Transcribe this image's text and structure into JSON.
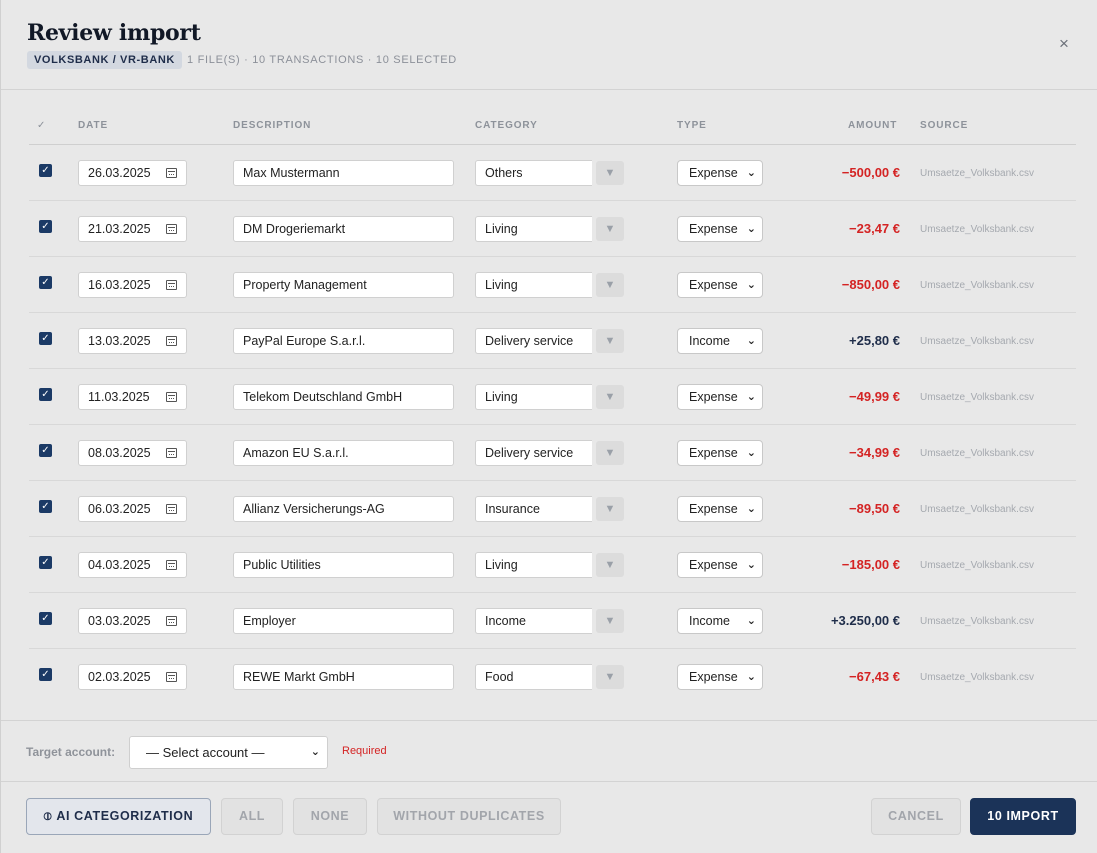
{
  "header": {
    "title": "Review import",
    "bank": "VOLKSBANK / VR-BANK",
    "meta": "1 FILE(S) · 10 TRANSACTIONS · 10 SELECTED",
    "close": "×"
  },
  "columns": {
    "check": "✓",
    "date": "DATE",
    "description": "DESCRIPTION",
    "category": "CATEGORY",
    "type": "TYPE",
    "amount": "AMOUNT",
    "source": "SOURCE"
  },
  "rows": [
    {
      "date": "26.03.2025",
      "description": "Max Mustermann",
      "category": "Others",
      "type": "Expense",
      "amount": "−500,00 €",
      "sign": "neg",
      "source": "Umsaetze_Volksbank.csv"
    },
    {
      "date": "21.03.2025",
      "description": "DM Drogeriemarkt",
      "category": "Living",
      "type": "Expense",
      "amount": "−23,47 €",
      "sign": "neg",
      "source": "Umsaetze_Volksbank.csv"
    },
    {
      "date": "16.03.2025",
      "description": "Property Management",
      "category": "Living",
      "type": "Expense",
      "amount": "−850,00 €",
      "sign": "neg",
      "source": "Umsaetze_Volksbank.csv"
    },
    {
      "date": "13.03.2025",
      "description": "PayPal Europe S.a.r.l.",
      "category": "Delivery service",
      "type": "Income",
      "amount": "+25,80 €",
      "sign": "pos",
      "source": "Umsaetze_Volksbank.csv"
    },
    {
      "date": "11.03.2025",
      "description": "Telekom Deutschland GmbH",
      "category": "Living",
      "type": "Expense",
      "amount": "−49,99 €",
      "sign": "neg",
      "source": "Umsaetze_Volksbank.csv"
    },
    {
      "date": "08.03.2025",
      "description": "Amazon EU S.a.r.l.",
      "category": "Delivery service",
      "type": "Expense",
      "amount": "−34,99 €",
      "sign": "neg",
      "source": "Umsaetze_Volksbank.csv"
    },
    {
      "date": "06.03.2025",
      "description": "Allianz Versicherungs-AG",
      "category": "Insurance",
      "type": "Expense",
      "amount": "−89,50 €",
      "sign": "neg",
      "source": "Umsaetze_Volksbank.csv"
    },
    {
      "date": "04.03.2025",
      "description": "Public Utilities",
      "category": "Living",
      "type": "Expense",
      "amount": "−185,00 €",
      "sign": "neg",
      "source": "Umsaetze_Volksbank.csv"
    },
    {
      "date": "03.03.2025",
      "description": "Employer",
      "category": "Income",
      "type": "Income",
      "amount": "+3.250,00 €",
      "sign": "pos",
      "source": "Umsaetze_Volksbank.csv"
    },
    {
      "date": "02.03.2025",
      "description": "REWE Markt GmbH",
      "category": "Food",
      "type": "Expense",
      "amount": "−67,43 €",
      "sign": "neg",
      "source": "Umsaetze_Volksbank.csv"
    }
  ],
  "account": {
    "label": "Target account:",
    "select_value": "— Select account —",
    "required": "Required"
  },
  "footer": {
    "ai_label": "AI CATEGORIZATION",
    "all_label": "ALL",
    "none_label": "NONE",
    "without_duplicates_label": "WITHOUT DUPLICATES",
    "cancel_label": "CANCEL",
    "import_label": "10 IMPORT"
  },
  "colors": {
    "expense": "#d42323",
    "income": "#1f2d4a",
    "primary": "#1b3358"
  }
}
